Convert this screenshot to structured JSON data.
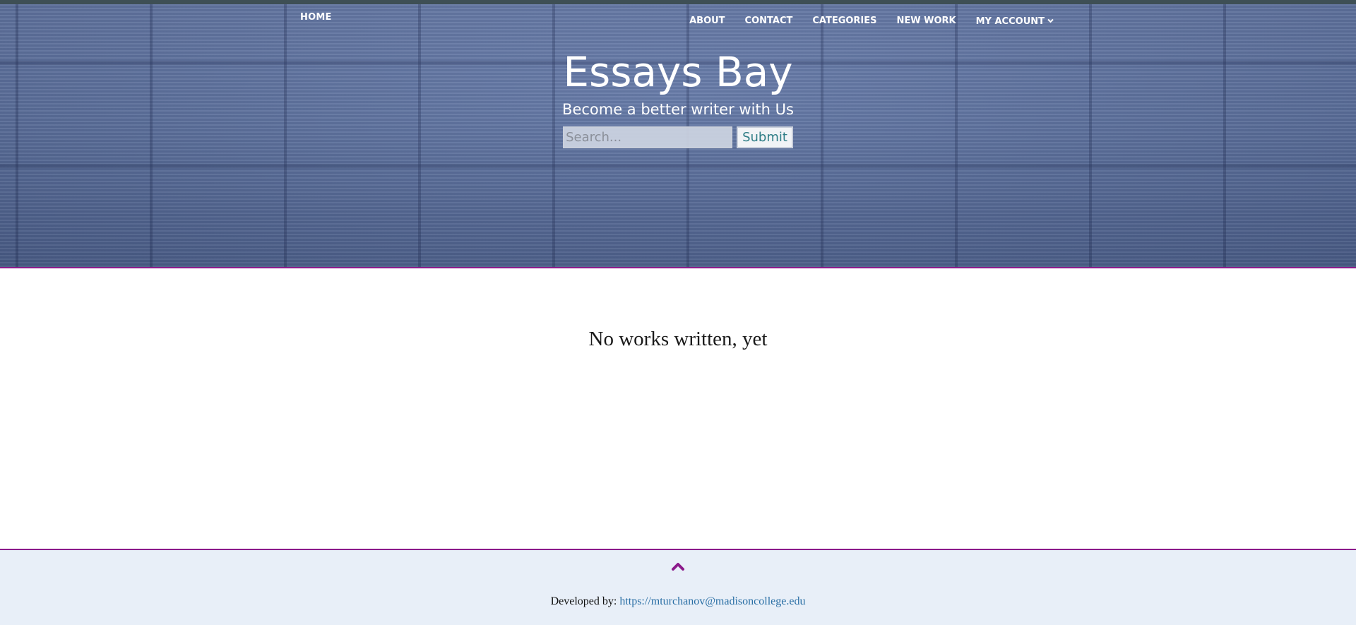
{
  "nav": {
    "home": "HOME",
    "items": [
      "ABOUT",
      "CONTACT",
      "CATEGORIES",
      "NEW WORK",
      "MY ACCOUNT"
    ]
  },
  "hero": {
    "title": "Essays Bay",
    "tagline": "Become a better writer with Us",
    "search_placeholder": "Search...",
    "submit_label": "Submit"
  },
  "main": {
    "empty_message": "No works written, yet"
  },
  "footer": {
    "developed_by_label": "Developed by:",
    "developer_link": "https://mturchanov@madisoncollege.edu"
  },
  "colors": {
    "accent_border": "#8b1a8b",
    "footer_bg": "#e8eff8",
    "link": "#2a6fa5",
    "submit_text": "#2e7d86"
  },
  "icons": {
    "account_dropdown": "chevron-down-icon",
    "back_to_top": "chevron-up-icon"
  }
}
